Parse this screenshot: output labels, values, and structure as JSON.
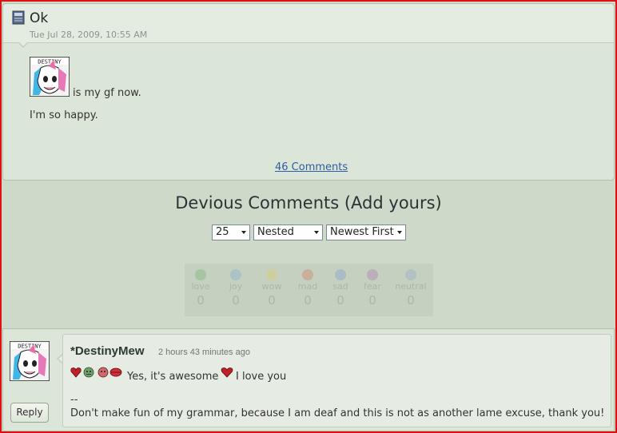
{
  "journal": {
    "title": "Ok",
    "date": "Tue Jul 28, 2009, 10:55 AM",
    "avatar_text": "DESTINY",
    "body_line1": "is my gf now.",
    "body_line2": "I'm so happy.",
    "comments_link": "46 Comments"
  },
  "section": {
    "title": "Devious Comments (Add yours)"
  },
  "filters": {
    "count": "25",
    "view": "Nested",
    "order": "Newest First"
  },
  "moods": [
    {
      "label": "love",
      "count": "0",
      "color": "#7fb57a"
    },
    {
      "label": "joy",
      "count": "0",
      "color": "#8fb3c9"
    },
    {
      "label": "wow",
      "count": "0",
      "color": "#d8d06a"
    },
    {
      "label": "mad",
      "count": "0",
      "color": "#d08a6a"
    },
    {
      "label": "sad",
      "count": "0",
      "color": "#8aa3c9"
    },
    {
      "label": "fear",
      "count": "0",
      "color": "#b08ab0"
    },
    {
      "label": "neutral",
      "count": "0",
      "color": "#99b0c8"
    }
  ],
  "comment": {
    "username": "*DestinyMew",
    "time": "2 hours 43 minutes ago",
    "text1": "Yes, it's awesome",
    "text2": "I love you",
    "sig_dash": "--",
    "signature": "Don't make fun of my grammar, because I am deaf and this is not as another lame excuse, thank you!",
    "reply_label": "Reply",
    "avatar_text": "DESTINY"
  }
}
